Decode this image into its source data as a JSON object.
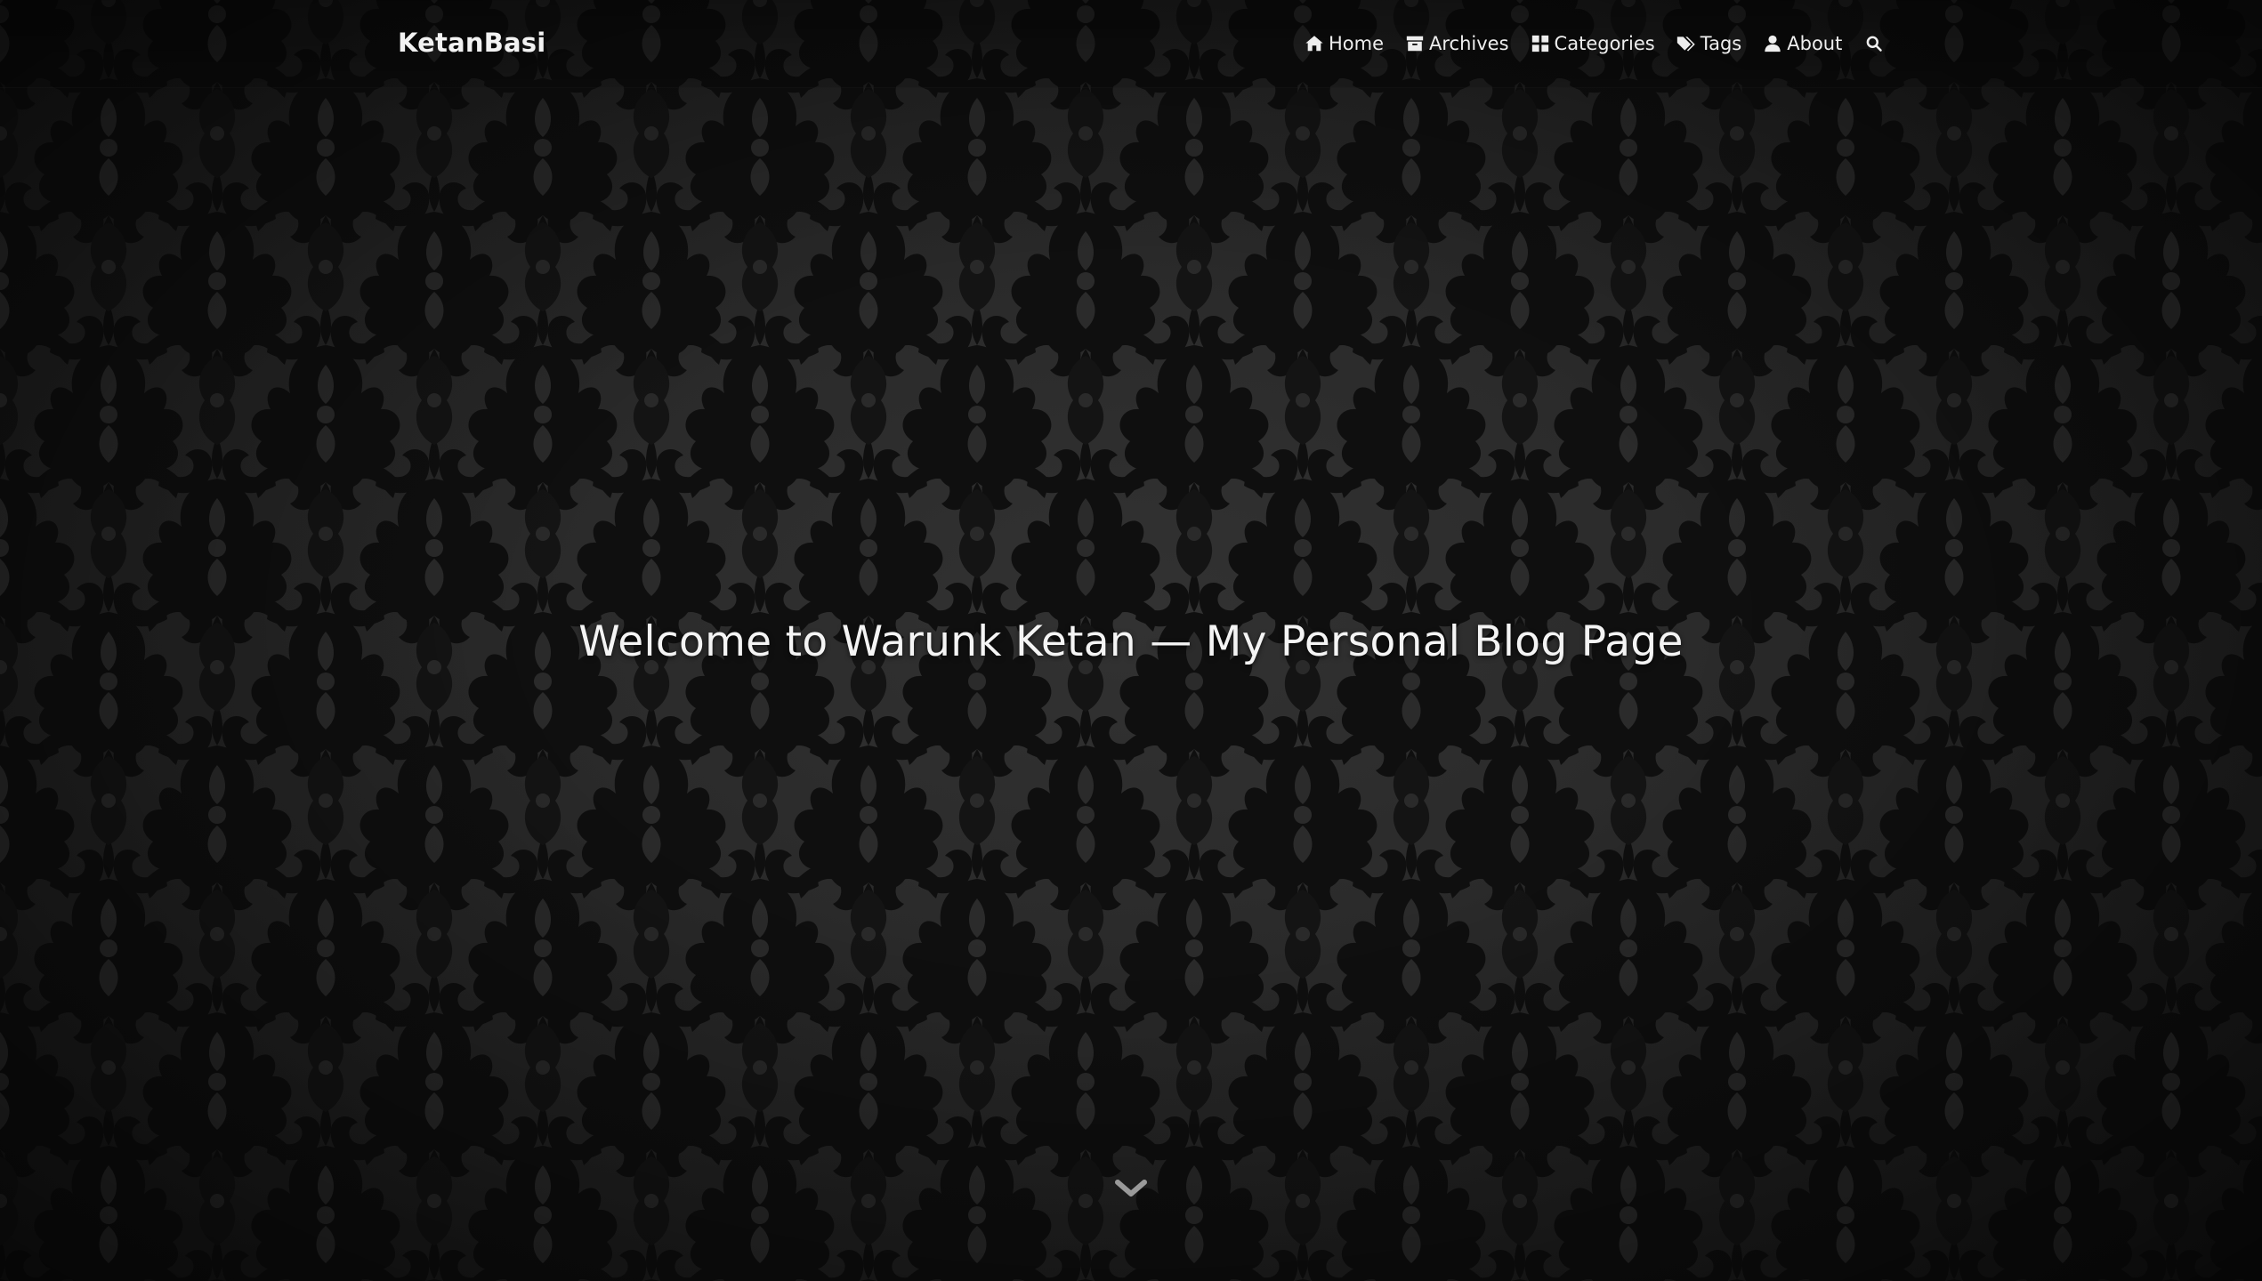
{
  "site": {
    "brand": "KetanBasi"
  },
  "nav": {
    "items": [
      {
        "label": "Home",
        "icon": "home-icon"
      },
      {
        "label": "Archives",
        "icon": "archive-icon"
      },
      {
        "label": "Categories",
        "icon": "categories-icon"
      },
      {
        "label": "Tags",
        "icon": "tags-icon"
      },
      {
        "label": "About",
        "icon": "user-icon"
      }
    ],
    "search_icon": "search-icon"
  },
  "hero": {
    "title": "Welcome to Warunk Ketan — My Personal Blog Page",
    "scroll_icon": "chevron-down-icon"
  },
  "colors": {
    "background": "#2a2a2a",
    "pattern": "#121212",
    "text": "#f2f2f2"
  }
}
